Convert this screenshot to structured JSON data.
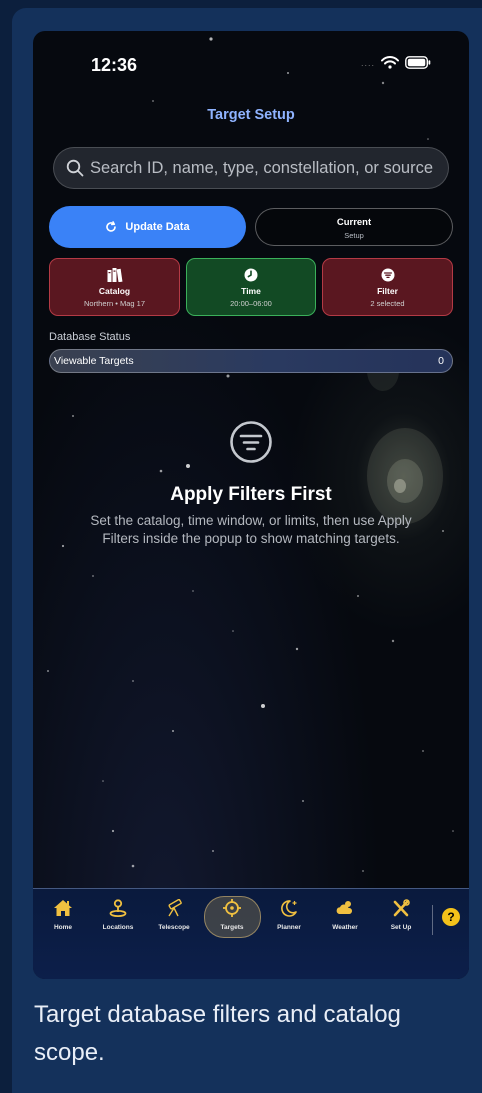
{
  "status": {
    "time": "12:36"
  },
  "header": {
    "title": "Target Setup"
  },
  "search": {
    "placeholder": "Search ID, name, type, constellation, or source"
  },
  "actions": {
    "update_label": "Update Data",
    "current_title": "Current",
    "current_sub": "Setup"
  },
  "tiles": [
    {
      "title": "Catalog",
      "sub": "Northern • Mag 17",
      "icon": "books-icon",
      "color": "#5a1720"
    },
    {
      "title": "Time",
      "sub": "20:00–06:00",
      "icon": "clock-icon",
      "color": "#124a24"
    },
    {
      "title": "Filter",
      "sub": "2 selected",
      "icon": "filter-icon",
      "color": "#5a1720"
    }
  ],
  "database": {
    "label": "Database Status",
    "row_label": "Viewable Targets",
    "row_value": "0"
  },
  "empty_state": {
    "icon": "filter-circle-icon",
    "title": "Apply Filters First",
    "text": "Set the catalog, time window, or limits, then use Apply Filters inside the popup to show matching targets."
  },
  "tabbar": {
    "items": [
      {
        "label": "Home",
        "icon": "home-icon"
      },
      {
        "label": "Locations",
        "icon": "location-icon"
      },
      {
        "label": "Telescope",
        "icon": "telescope-icon"
      },
      {
        "label": "Targets",
        "icon": "crosshair-icon",
        "active": true
      },
      {
        "label": "Planner",
        "icon": "moon-icon"
      },
      {
        "label": "Weather",
        "icon": "cloud-sun-icon"
      },
      {
        "label": "Set Up",
        "icon": "tools-icon"
      }
    ],
    "help": "?"
  },
  "caption": "Target database filters and catalog scope.",
  "colors": {
    "accent": "#3a82f7",
    "title": "#8fb3ff",
    "help": "#f4c21a",
    "icon_gold": "#f0c040"
  }
}
